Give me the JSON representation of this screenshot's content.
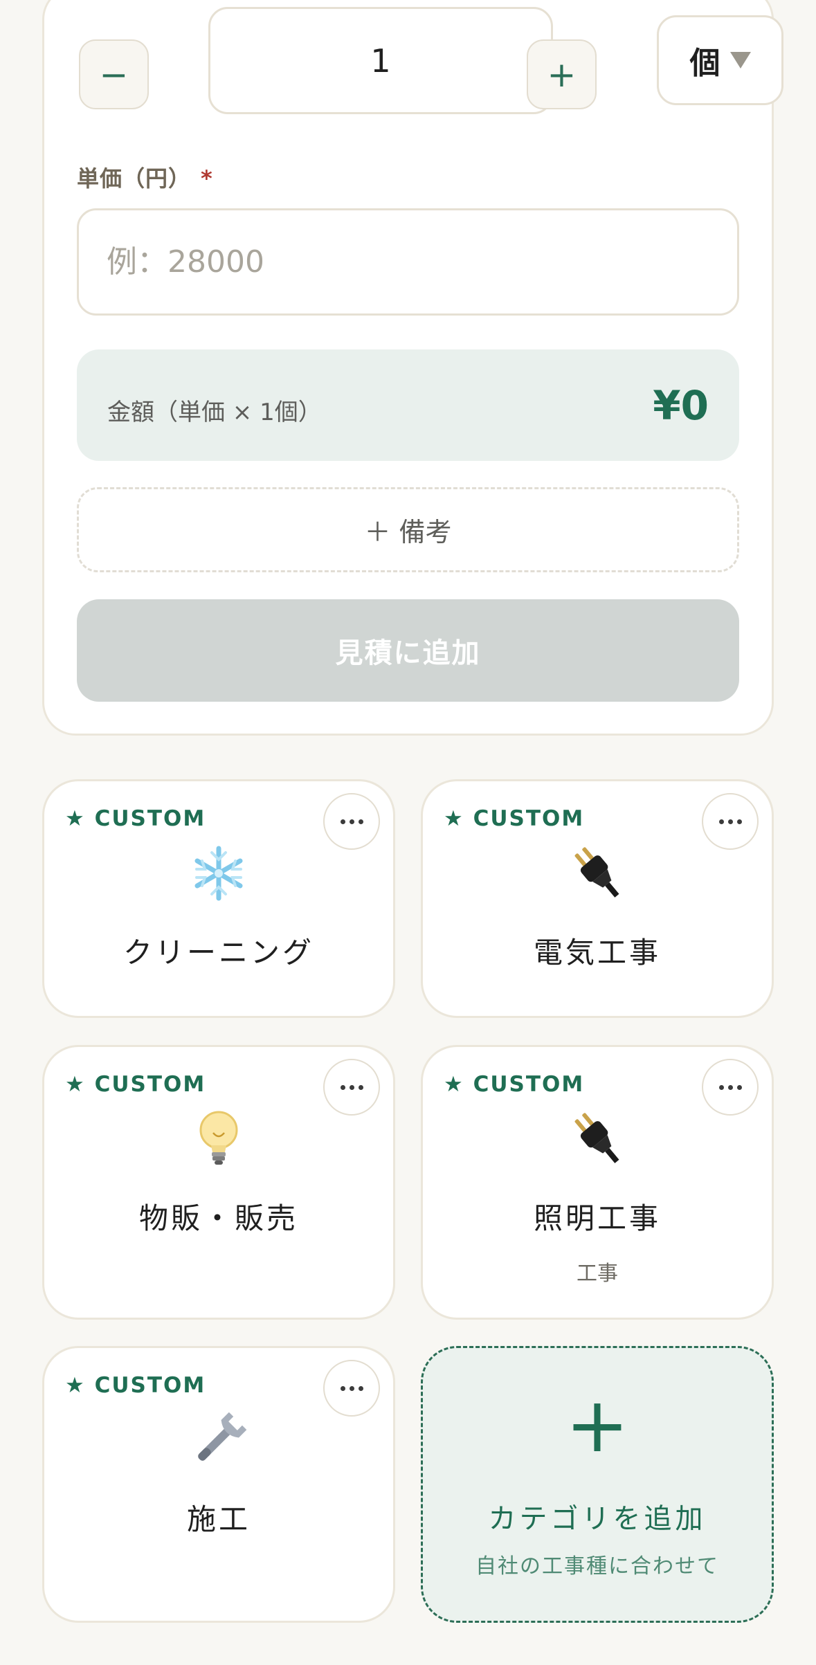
{
  "form": {
    "quantity": {
      "minus_label": "−",
      "value": "1",
      "plus_label": "+",
      "unit": "個"
    },
    "unit_price": {
      "label": "単価（円）",
      "required_mark": "*",
      "placeholder": "例：28000",
      "value": ""
    },
    "amount": {
      "label": "金額（単価 × 1個）",
      "value": "¥0"
    },
    "note_button_label": "＋ 備考",
    "add_button_label": "見積に追加"
  },
  "categories": [
    {
      "badge": "★ CUSTOM",
      "icon": "snowflake-icon",
      "name": "クリーニング",
      "sub": ""
    },
    {
      "badge": "★ CUSTOM",
      "icon": "plug-icon",
      "name": "電気工事",
      "sub": ""
    },
    {
      "badge": "★ CUSTOM",
      "icon": "light-bulb-icon",
      "name": "物販・販売",
      "sub": ""
    },
    {
      "badge": "★ CUSTOM",
      "icon": "plug-icon",
      "name": "照明工事",
      "sub": "工事"
    },
    {
      "badge": "★ CUSTOM",
      "icon": "wrench-icon",
      "name": "施工",
      "sub": ""
    }
  ],
  "add_category": {
    "plus": "+",
    "title": "カテゴリを追加",
    "subtitle": "自社の工事種に合わせて"
  },
  "colors": {
    "accent": "#1f6e53",
    "amount_bg": "#e9f0ed",
    "disabled_button": "#d0d5d3",
    "required": "#b03a32",
    "page_bg": "#f8f7f3"
  }
}
